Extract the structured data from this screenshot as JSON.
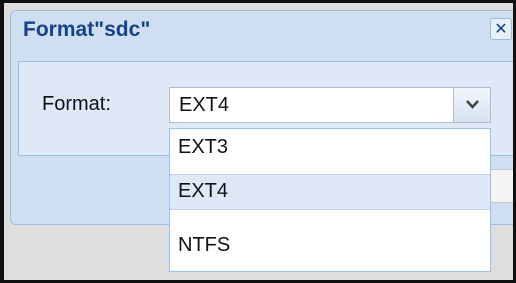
{
  "dialog": {
    "title": "Format\"sdc\"",
    "close_icon": "close-icon",
    "format_label": "Format:",
    "format_value": "EXT4",
    "dropdown_icon": "chevron-down-icon",
    "options": [
      "EXT3",
      "EXT4",
      "NTFS"
    ],
    "selected_option": "EXT4"
  },
  "colors": {
    "title": "#15428b",
    "panel": "#dfe8f6",
    "header": "#cfdff1",
    "border": "#99bbe8"
  }
}
